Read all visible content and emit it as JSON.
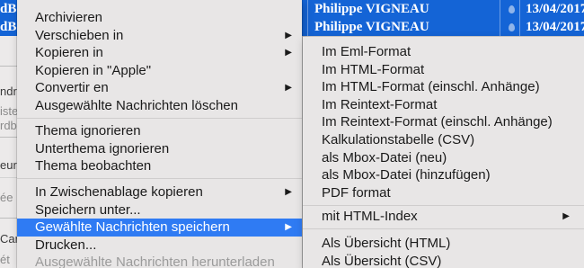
{
  "background": {
    "selected_rows": [
      {
        "from": "Philippe VIGNEAU",
        "date": "13/04/2017",
        "left_fragment": "dBo"
      },
      {
        "from": "Philippe VIGNEAU",
        "date": "13/04/2017",
        "left_fragment": "dBo"
      }
    ],
    "left_fragments": [
      "ndre",
      "iste",
      "rdb",
      "eur",
      "ée",
      "Car",
      "ét"
    ]
  },
  "menu": {
    "items": [
      {
        "label": "Archivieren",
        "submenu": false
      },
      {
        "label": "Verschieben in",
        "submenu": true
      },
      {
        "label": "Kopieren in",
        "submenu": true
      },
      {
        "label": "Kopieren in \"Apple\"",
        "submenu": false
      },
      {
        "label": "Convertir en",
        "submenu": true
      },
      {
        "label": "Ausgewählte Nachrichten löschen",
        "submenu": false
      },
      {
        "label": "Thema ignorieren",
        "submenu": false
      },
      {
        "label": "Unterthema ignorieren",
        "submenu": false
      },
      {
        "label": "Thema beobachten",
        "submenu": false
      },
      {
        "label": "In Zwischenablage kopieren",
        "submenu": true
      },
      {
        "label": "Speichern unter...",
        "submenu": false
      },
      {
        "label": "Gewählte Nachrichten speichern",
        "submenu": true,
        "active": true
      },
      {
        "label": "Drucken...",
        "submenu": false
      },
      {
        "label": "Ausgewählte Nachrichten herunterladen",
        "submenu": false,
        "disabled": true
      }
    ],
    "arrow_glyph": "▶"
  },
  "submenu": {
    "items": [
      {
        "label": "Im Eml-Format"
      },
      {
        "label": "Im HTML-Format"
      },
      {
        "label": "Im HTML-Format (einschl. Anhänge)"
      },
      {
        "label": "Im Reintext-Format"
      },
      {
        "label": "Im Reintext-Format (einschl. Anhänge)"
      },
      {
        "label": "Kalkulationstabelle (CSV)"
      },
      {
        "label": "als Mbox-Datei (neu)"
      },
      {
        "label": "als Mbox-Datei (hinzufügen)"
      },
      {
        "label": "PDF format"
      },
      {
        "label": "mit HTML-Index",
        "submenu": true
      },
      {
        "label": "Als Übersicht (HTML)"
      },
      {
        "label": "Als Übersicht (CSV)"
      }
    ]
  },
  "colors": {
    "selection": "#1464d6",
    "menu_highlight": "#2f7bf3",
    "menu_background": "#e8e6e6"
  }
}
